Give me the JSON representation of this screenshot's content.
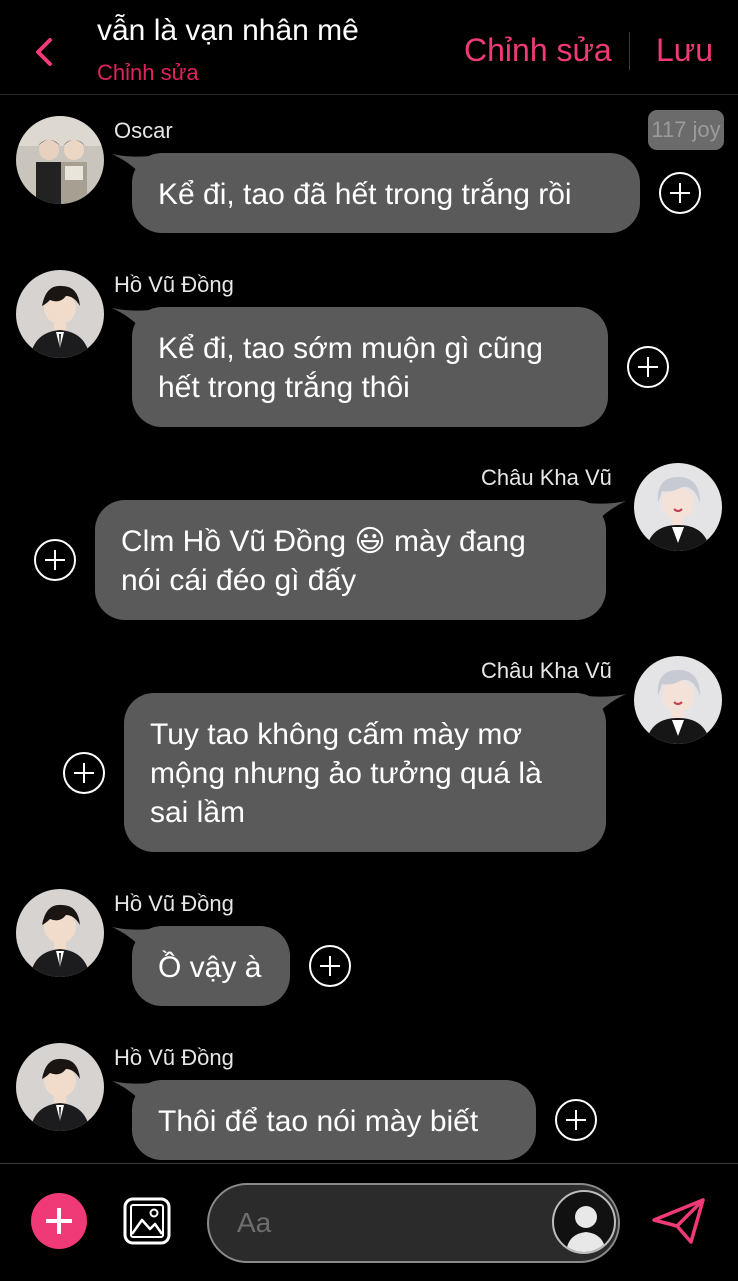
{
  "header": {
    "title": "vẫn là vạn nhân mê",
    "subtitle": "Chỉnh sửa",
    "edit_label": "Chỉnh sửa",
    "save_label": "Lưu"
  },
  "badge": {
    "text": "117 joy"
  },
  "messages": [
    {
      "sender": "Oscar",
      "lines": [
        "Kể đi, tao đã hết trong trắng rồi"
      ]
    },
    {
      "sender": "Hồ Vũ Đồng",
      "lines": [
        "Kể đi, tao sớm muộn gì cũng",
        "hết trong trắng thôi"
      ]
    },
    {
      "sender": "Châu Kha Vũ",
      "lines": [
        "Clm Hồ Vũ Đồng 😃 mày đang",
        "nói cái đéo gì đấy"
      ]
    },
    {
      "sender": "Châu Kha Vũ",
      "lines": [
        "Tuy tao không cấm mày mơ",
        "mộng nhưng ảo tưởng quá là",
        "sai lầm"
      ]
    },
    {
      "sender": "Hồ Vũ Đồng",
      "lines": [
        "Ồ vậy à"
      ]
    },
    {
      "sender": "Hồ Vũ Đồng",
      "lines": [
        "Thôi để tao nói mày biết"
      ]
    }
  ],
  "composer": {
    "placeholder": "Aa"
  },
  "colors": {
    "accent": "#ef3a77",
    "bubble": "#5a5a5a",
    "background": "#000000"
  }
}
